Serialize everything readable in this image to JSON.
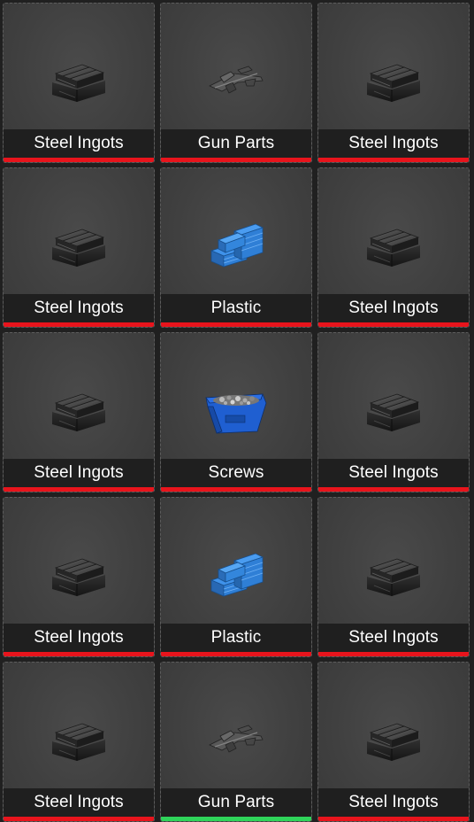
{
  "inventory": {
    "items": [
      {
        "name": "Steel Ingots",
        "icon": "steel-ingots-icon",
        "status": "red"
      },
      {
        "name": "Gun Parts",
        "icon": "gun-parts-icon",
        "status": "red"
      },
      {
        "name": "Steel Ingots",
        "icon": "steel-ingots-icon",
        "status": "red"
      },
      {
        "name": "Steel Ingots",
        "icon": "steel-ingots-icon",
        "status": "red"
      },
      {
        "name": "Plastic",
        "icon": "plastic-icon",
        "status": "red"
      },
      {
        "name": "Steel Ingots",
        "icon": "steel-ingots-icon",
        "status": "red"
      },
      {
        "name": "Steel Ingots",
        "icon": "steel-ingots-icon",
        "status": "red"
      },
      {
        "name": "Screws",
        "icon": "screws-icon",
        "status": "red"
      },
      {
        "name": "Steel Ingots",
        "icon": "steel-ingots-icon",
        "status": "red"
      },
      {
        "name": "Steel Ingots",
        "icon": "steel-ingots-icon",
        "status": "red"
      },
      {
        "name": "Plastic",
        "icon": "plastic-icon",
        "status": "red"
      },
      {
        "name": "Steel Ingots",
        "icon": "steel-ingots-icon",
        "status": "red"
      },
      {
        "name": "Steel Ingots",
        "icon": "steel-ingots-icon",
        "status": "red"
      },
      {
        "name": "Gun Parts",
        "icon": "gun-parts-icon",
        "status": "green"
      },
      {
        "name": "Steel Ingots",
        "icon": "steel-ingots-icon",
        "status": "red"
      }
    ]
  },
  "colors": {
    "status_red": "#e8141c",
    "status_green": "#2fd45a",
    "plastic_blue": "#2f7fd6",
    "steel_gray": "#3a3a3a"
  }
}
